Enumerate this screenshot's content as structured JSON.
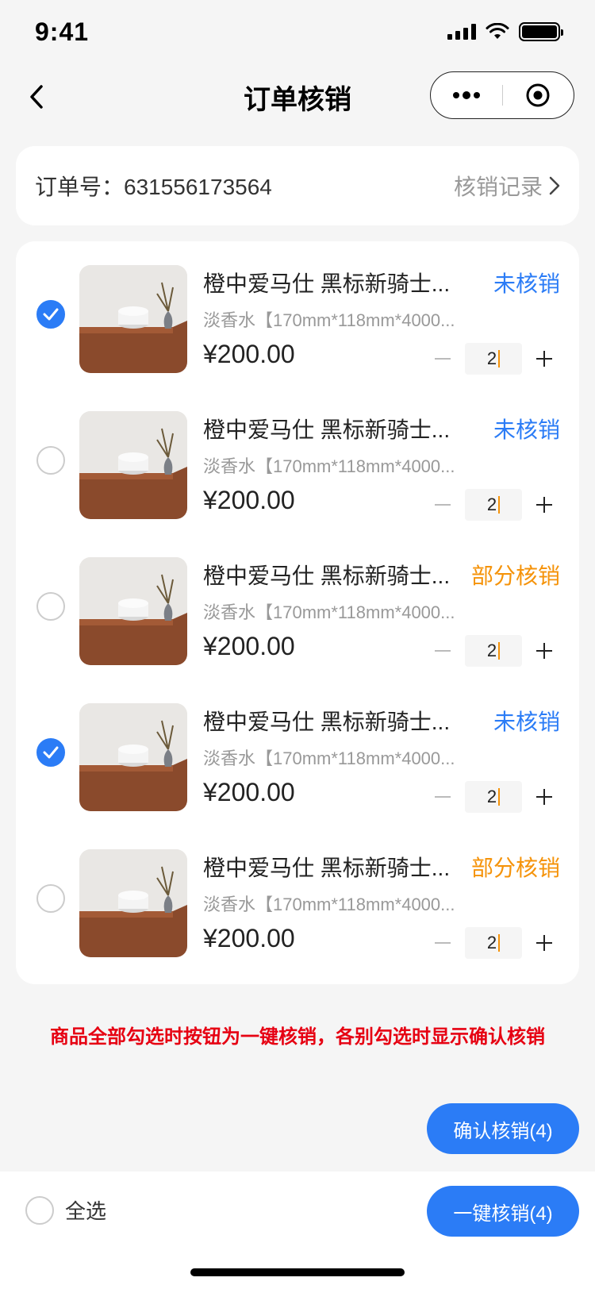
{
  "status_bar": {
    "time": "9:41"
  },
  "nav": {
    "title": "订单核销"
  },
  "order": {
    "number_label": "订单号：631556173564",
    "records_link": "核销记录"
  },
  "products": [
    {
      "title": "橙中爱马仕 黑标新骑士...",
      "spec": "淡香水【170mm*118mm*4000...",
      "price": "¥200.00",
      "quantity": "2",
      "status": "未核销",
      "status_type": "pending",
      "checked": true
    },
    {
      "title": "橙中爱马仕 黑标新骑士...",
      "spec": "淡香水【170mm*118mm*4000...",
      "price": "¥200.00",
      "quantity": "2",
      "status": "未核销",
      "status_type": "pending",
      "checked": false
    },
    {
      "title": "橙中爱马仕 黑标新骑士...",
      "spec": "淡香水【170mm*118mm*4000...",
      "price": "¥200.00",
      "quantity": "2",
      "status": "部分核销",
      "status_type": "partial",
      "checked": false
    },
    {
      "title": "橙中爱马仕 黑标新骑士...",
      "spec": "淡香水【170mm*118mm*4000...",
      "price": "¥200.00",
      "quantity": "2",
      "status": "未核销",
      "status_type": "pending",
      "checked": true
    },
    {
      "title": "橙中爱马仕 黑标新骑士...",
      "spec": "淡香水【170mm*118mm*4000...",
      "price": "¥200.00",
      "quantity": "2",
      "status": "部分核销",
      "status_type": "partial",
      "checked": false
    }
  ],
  "notice": "商品全部勾选时按钮为一键核销，各别勾选时显示确认核销",
  "actions": {
    "confirm_label": "确认核销(4)",
    "one_click_label": "一键核销(4)",
    "select_all_label": "全选"
  },
  "colors": {
    "accent": "#2b7cf6",
    "partial": "#f5930a",
    "notice": "#e60012"
  }
}
